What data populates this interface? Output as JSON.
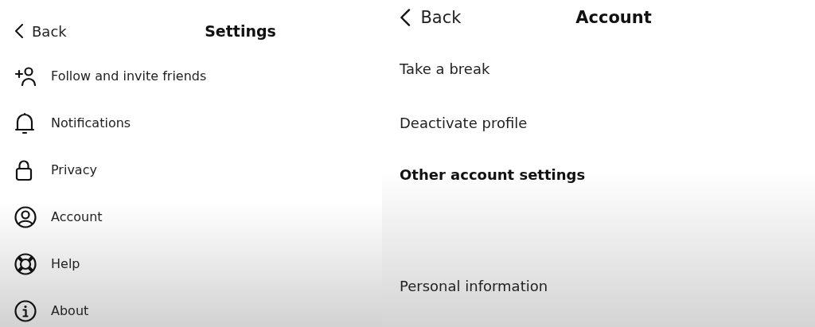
{
  "settings_screen": {
    "back": {
      "label": "Back"
    },
    "title": "Settings",
    "items": [
      {
        "label": "Follow and invite friends"
      },
      {
        "label": "Notifications"
      },
      {
        "label": "Privacy"
      },
      {
        "label": "Account"
      },
      {
        "label": "Help"
      },
      {
        "label": "About"
      }
    ]
  },
  "account_screen": {
    "back": {
      "label": "Back"
    },
    "title": "Account",
    "items": [
      {
        "kind": "item",
        "label": "Take a break"
      },
      {
        "kind": "item",
        "label": "Deactivate profile"
      },
      {
        "kind": "section",
        "label": "Other account settings"
      },
      {
        "kind": "item",
        "label": "Personal information"
      }
    ]
  }
}
